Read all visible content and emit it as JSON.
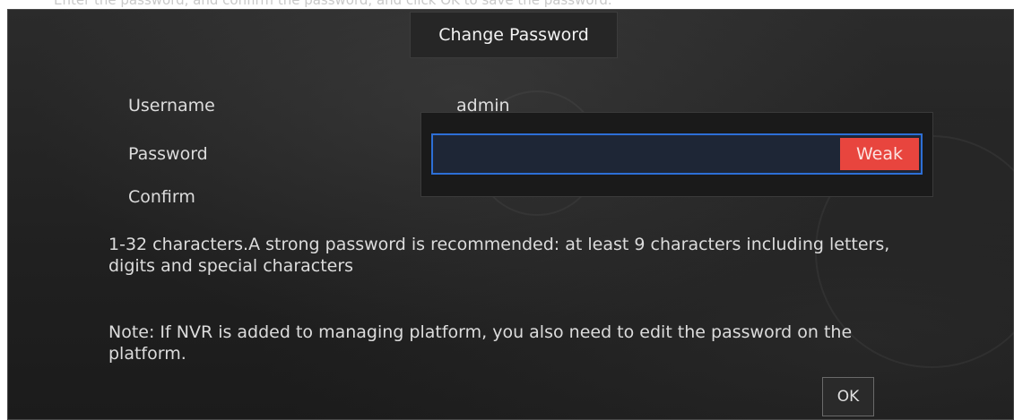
{
  "top_cut_text": "Enter the password, and confirm the password, and click OK to save the password.",
  "dialog": {
    "title": "Change Password",
    "fields": {
      "username_label": "Username",
      "username_value": "admin",
      "password_label": "Password",
      "password_strength": "Weak",
      "confirm_label": "Confirm"
    },
    "info_text": "1-32 characters.A strong password is recommended: at least 9 characters including letters, digits and special characters",
    "note_text": "Note: If NVR is added to managing platform, you also need to edit the password on the platform.",
    "ok_label": "OK"
  },
  "colors": {
    "dialog_background": "#222222",
    "focus_border": "#2d6fd6",
    "weak_badge": "#e8453e"
  }
}
